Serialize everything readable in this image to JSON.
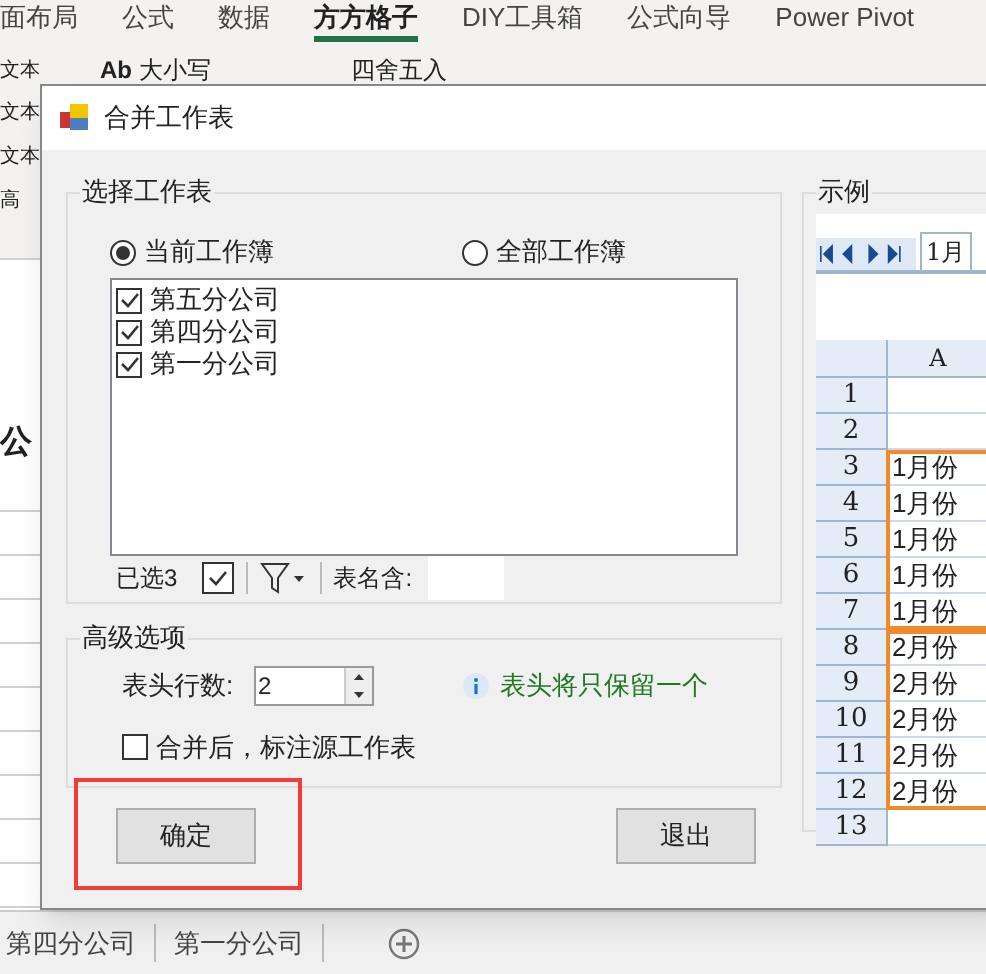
{
  "ribbon_tabs": [
    {
      "label": "面布局",
      "selected": false
    },
    {
      "label": "公式",
      "selected": false
    },
    {
      "label": "数据",
      "selected": false
    },
    {
      "label": "方方格子",
      "selected": true
    },
    {
      "label": "DIY工具箱",
      "selected": false
    },
    {
      "label": "公式向导",
      "selected": false
    },
    {
      "label": "Power Pivot",
      "selected": false
    }
  ],
  "ribbon_row": {
    "first": "文本",
    "case_icon": "Ab",
    "case_label": "大小写",
    "round_label": "四舍五入"
  },
  "left_texts": [
    "文本",
    "文本",
    "高"
  ],
  "cell_text": "公",
  "dialog": {
    "title": "合并工作表",
    "select_group": {
      "title": "选择工作表",
      "scopes": [
        {
          "label": "当前工作簿",
          "selected": true
        },
        {
          "label": "全部工作簿",
          "selected": false
        }
      ],
      "sheets": [
        {
          "label": "第五分公司",
          "checked": true
        },
        {
          "label": "第四分公司",
          "checked": true
        },
        {
          "label": "第一分公司",
          "checked": true
        }
      ],
      "selected_count": "已选3",
      "select_all_checked": true,
      "name_filter_label": "表名含:"
    },
    "advanced": {
      "title": "高级选项",
      "header_rows_label": "表头行数:",
      "header_rows_value": "2",
      "hint": "表头将只保留一个",
      "annotate": {
        "label": "合并后，标注源工作表",
        "checked": false
      }
    },
    "buttons": [
      {
        "label": "确定",
        "highlighted": true
      },
      {
        "label": "退出",
        "highlighted": false
      }
    ],
    "example": {
      "title": "示例",
      "tab": "1月",
      "column": "A",
      "leading_rows": [
        "1",
        "2"
      ],
      "blocks": [
        {
          "rows": [
            {
              "n": "3",
              "value": "1月份"
            },
            {
              "n": "4",
              "value": "1月份"
            },
            {
              "n": "5",
              "value": "1月份"
            },
            {
              "n": "6",
              "value": "1月份"
            },
            {
              "n": "7",
              "value": "1月份"
            }
          ]
        },
        {
          "rows": [
            {
              "n": "8",
              "value": "2月份"
            },
            {
              "n": "9",
              "value": "2月份"
            },
            {
              "n": "10",
              "value": "2月份"
            },
            {
              "n": "11",
              "value": "2月份"
            },
            {
              "n": "12",
              "value": "2月份"
            }
          ]
        }
      ],
      "trailing_rows": [
        "13"
      ]
    }
  },
  "sheet_tabs": [
    {
      "label": "第四分公司",
      "selected": false
    },
    {
      "label": "第一分公司",
      "selected": false
    }
  ]
}
